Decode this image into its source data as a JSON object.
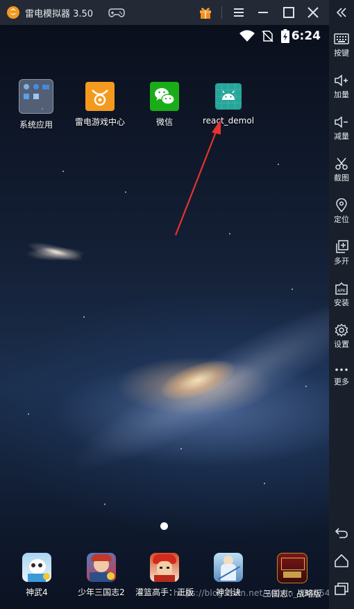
{
  "window": {
    "title": "雷电模拟器 3.50",
    "accent_color": "#f29a1f"
  },
  "status_bar": {
    "time": "6:24",
    "icons": [
      "wifi-icon",
      "no-sim-icon",
      "battery-charging-icon"
    ]
  },
  "home": {
    "apps": [
      {
        "label": "系统应用",
        "icon": "system-apps-folder-icon"
      },
      {
        "label": "雷电游戏中心",
        "icon": "game-center-icon"
      },
      {
        "label": "微信",
        "icon": "wechat-icon"
      },
      {
        "label": "react_demol",
        "icon": "android-icon"
      }
    ],
    "dock": [
      {
        "label": "神武4",
        "icon": "panda-game-icon"
      },
      {
        "label": "少年三国志2",
        "icon": "warrior-game-icon"
      },
      {
        "label": "灌篮高手：正版",
        "icon": "basketball-anime-icon"
      },
      {
        "label": "神剑诀",
        "icon": "sword-game-icon"
      },
      {
        "label": "三国志：战略版",
        "icon": "three-kingdoms-icon"
      }
    ]
  },
  "sidebar": {
    "items": [
      {
        "label": "按键",
        "icon": "keyboard-icon"
      },
      {
        "label": "加量",
        "icon": "volume-up-icon"
      },
      {
        "label": "减量",
        "icon": "volume-down-icon"
      },
      {
        "label": "截图",
        "icon": "scissors-icon"
      },
      {
        "label": "定位",
        "icon": "location-pin-icon"
      },
      {
        "label": "多开",
        "icon": "multi-instance-icon"
      },
      {
        "label": "安装",
        "icon": "apk-install-icon"
      },
      {
        "label": "设置",
        "icon": "gear-icon"
      },
      {
        "label": "更多",
        "icon": "more-dots-icon"
      }
    ],
    "nav": [
      "back-icon",
      "home-icon",
      "recents-icon"
    ]
  },
  "watermark": "https://blog.csdn.net/weixin_43865425"
}
